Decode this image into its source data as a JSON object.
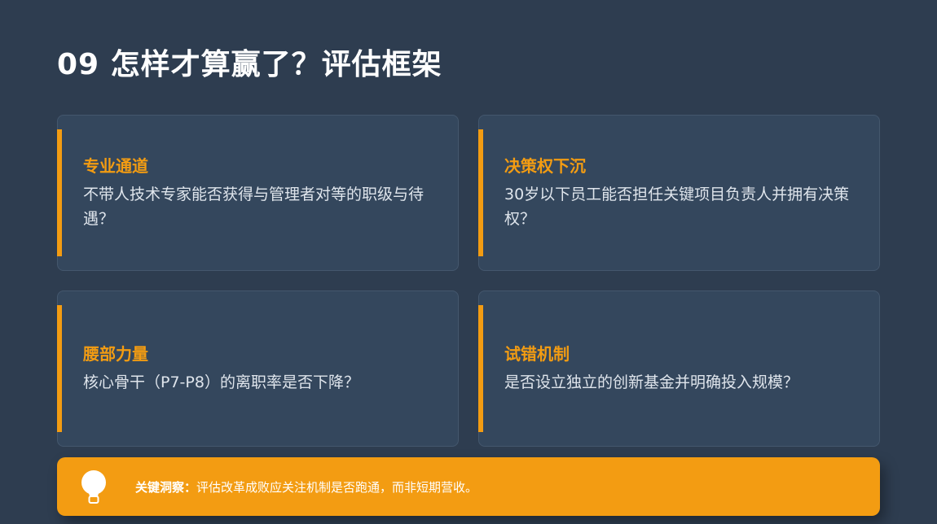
{
  "page": {
    "title": "09 怎样才算赢了？评估框架"
  },
  "cards": [
    {
      "heading": "专业通道",
      "text": "不带人技术专家能否获得与管理者对等的职级与待遇？"
    },
    {
      "heading": "决策权下沉",
      "text": "30岁以下员工能否担任关键项目负责人并拥有决策权？"
    },
    {
      "heading": "腰部力量",
      "text": "核心骨干（P7-P8）的离职率是否下降？"
    },
    {
      "heading": "试错机制",
      "text": "是否设立独立的创新基金并明确投入规模？"
    }
  ],
  "insight": {
    "icon": "lightbulb-icon",
    "label": "关键洞察：",
    "text": "评估改革成败应关注机制是否跑通，而非短期营收。"
  },
  "colors": {
    "background": "#2e3d50",
    "card": "#34475d",
    "accent": "#f39c12",
    "title": "#ffffff",
    "body_text": "#dfe5ec"
  }
}
